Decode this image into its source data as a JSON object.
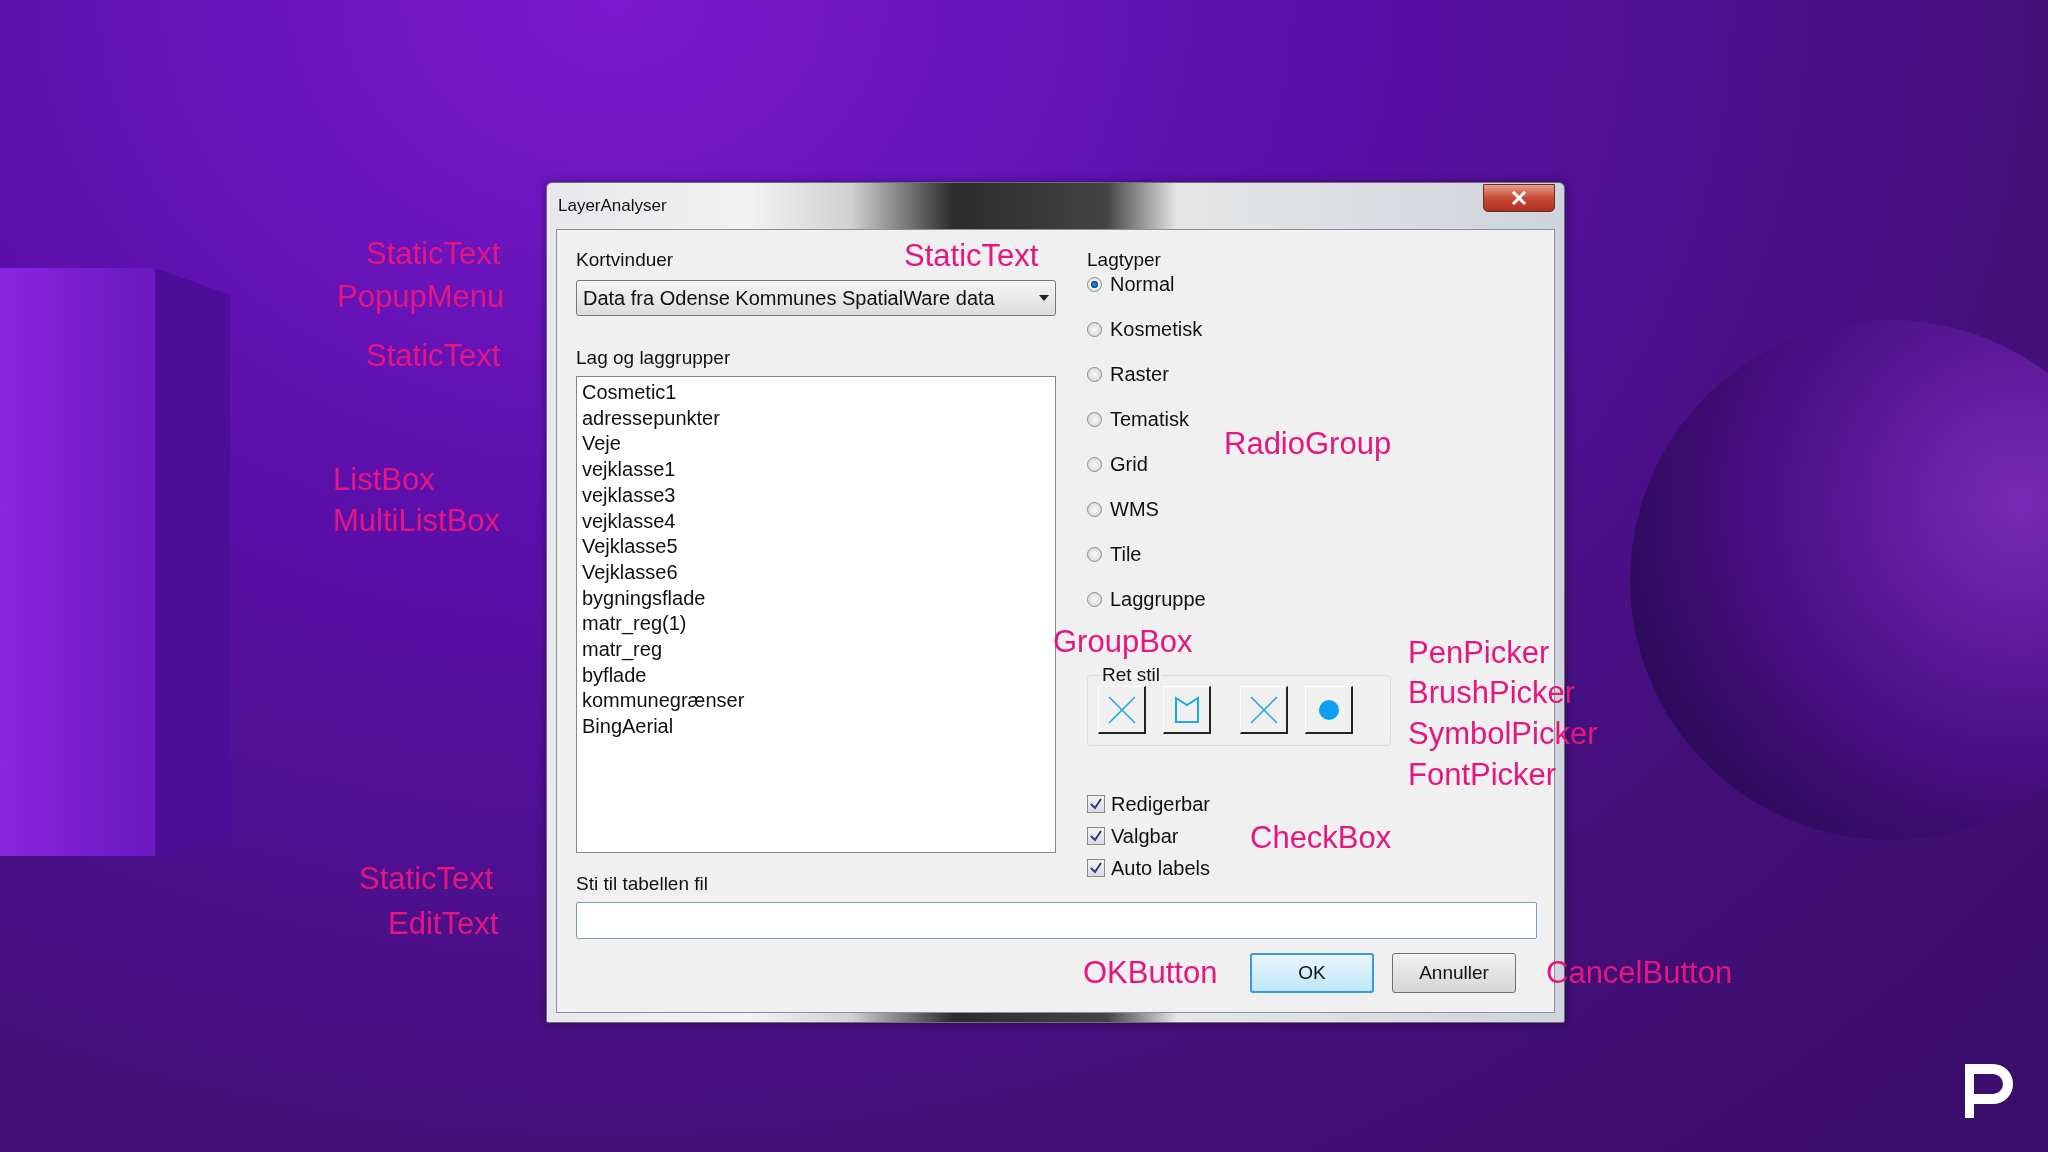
{
  "annotations": [
    {
      "text": "StaticText"
    },
    {
      "text": "PopupMenu"
    },
    {
      "text": "StaticText"
    },
    {
      "text": "ListBox"
    },
    {
      "text": "MultiListBox"
    },
    {
      "text": "StaticText"
    },
    {
      "text": "RadioGroup"
    },
    {
      "text": "GroupBox"
    },
    {
      "text": "PenPicker"
    },
    {
      "text": "BrushPicker"
    },
    {
      "text": "SymbolPicker"
    },
    {
      "text": "FontPicker"
    },
    {
      "text": "CheckBox"
    },
    {
      "text": "StaticText"
    },
    {
      "text": "EditText"
    },
    {
      "text": "OKButton"
    },
    {
      "text": "CancelButton"
    }
  ],
  "window": {
    "title": "LayerAnalyser"
  },
  "map_windows": {
    "label": "Kortvinduer",
    "value": "Data fra Odense Kommunes SpatialWare data"
  },
  "layers": {
    "label": "Lag og laggrupper",
    "items": [
      "Cosmetic1",
      "adressepunkter",
      "Veje",
      "vejklasse1",
      "vejklasse3",
      "vejklasse4",
      "Vejklasse5",
      "Vejklasse6",
      "bygningsflade",
      "matr_reg(1)",
      "matr_reg",
      "byflade",
      "kommunegrænser",
      "BingAerial"
    ]
  },
  "layer_types": {
    "label": "Lagtyper",
    "options": [
      {
        "label": "Normal",
        "selected": true
      },
      {
        "label": "Kosmetisk",
        "selected": false
      },
      {
        "label": "Raster",
        "selected": false
      },
      {
        "label": "Tematisk",
        "selected": false
      },
      {
        "label": "Grid",
        "selected": false
      },
      {
        "label": "WMS",
        "selected": false
      },
      {
        "label": "Tile",
        "selected": false
      },
      {
        "label": "Laggruppe",
        "selected": false
      }
    ]
  },
  "style_group": {
    "label": "Ret stil",
    "pickers": [
      {
        "kind": "cross"
      },
      {
        "kind": "frame"
      },
      {
        "kind": "cross"
      },
      {
        "kind": "dot"
      }
    ]
  },
  "options": [
    {
      "label": "Redigerbar",
      "checked": true
    },
    {
      "label": "Valgbar",
      "checked": true
    },
    {
      "label": "Auto labels",
      "checked": true
    }
  ],
  "path": {
    "label": "Sti til tabellen fil"
  },
  "buttons": [
    {
      "label": "OK",
      "default": true
    },
    {
      "label": "Annuller",
      "default": false
    }
  ]
}
